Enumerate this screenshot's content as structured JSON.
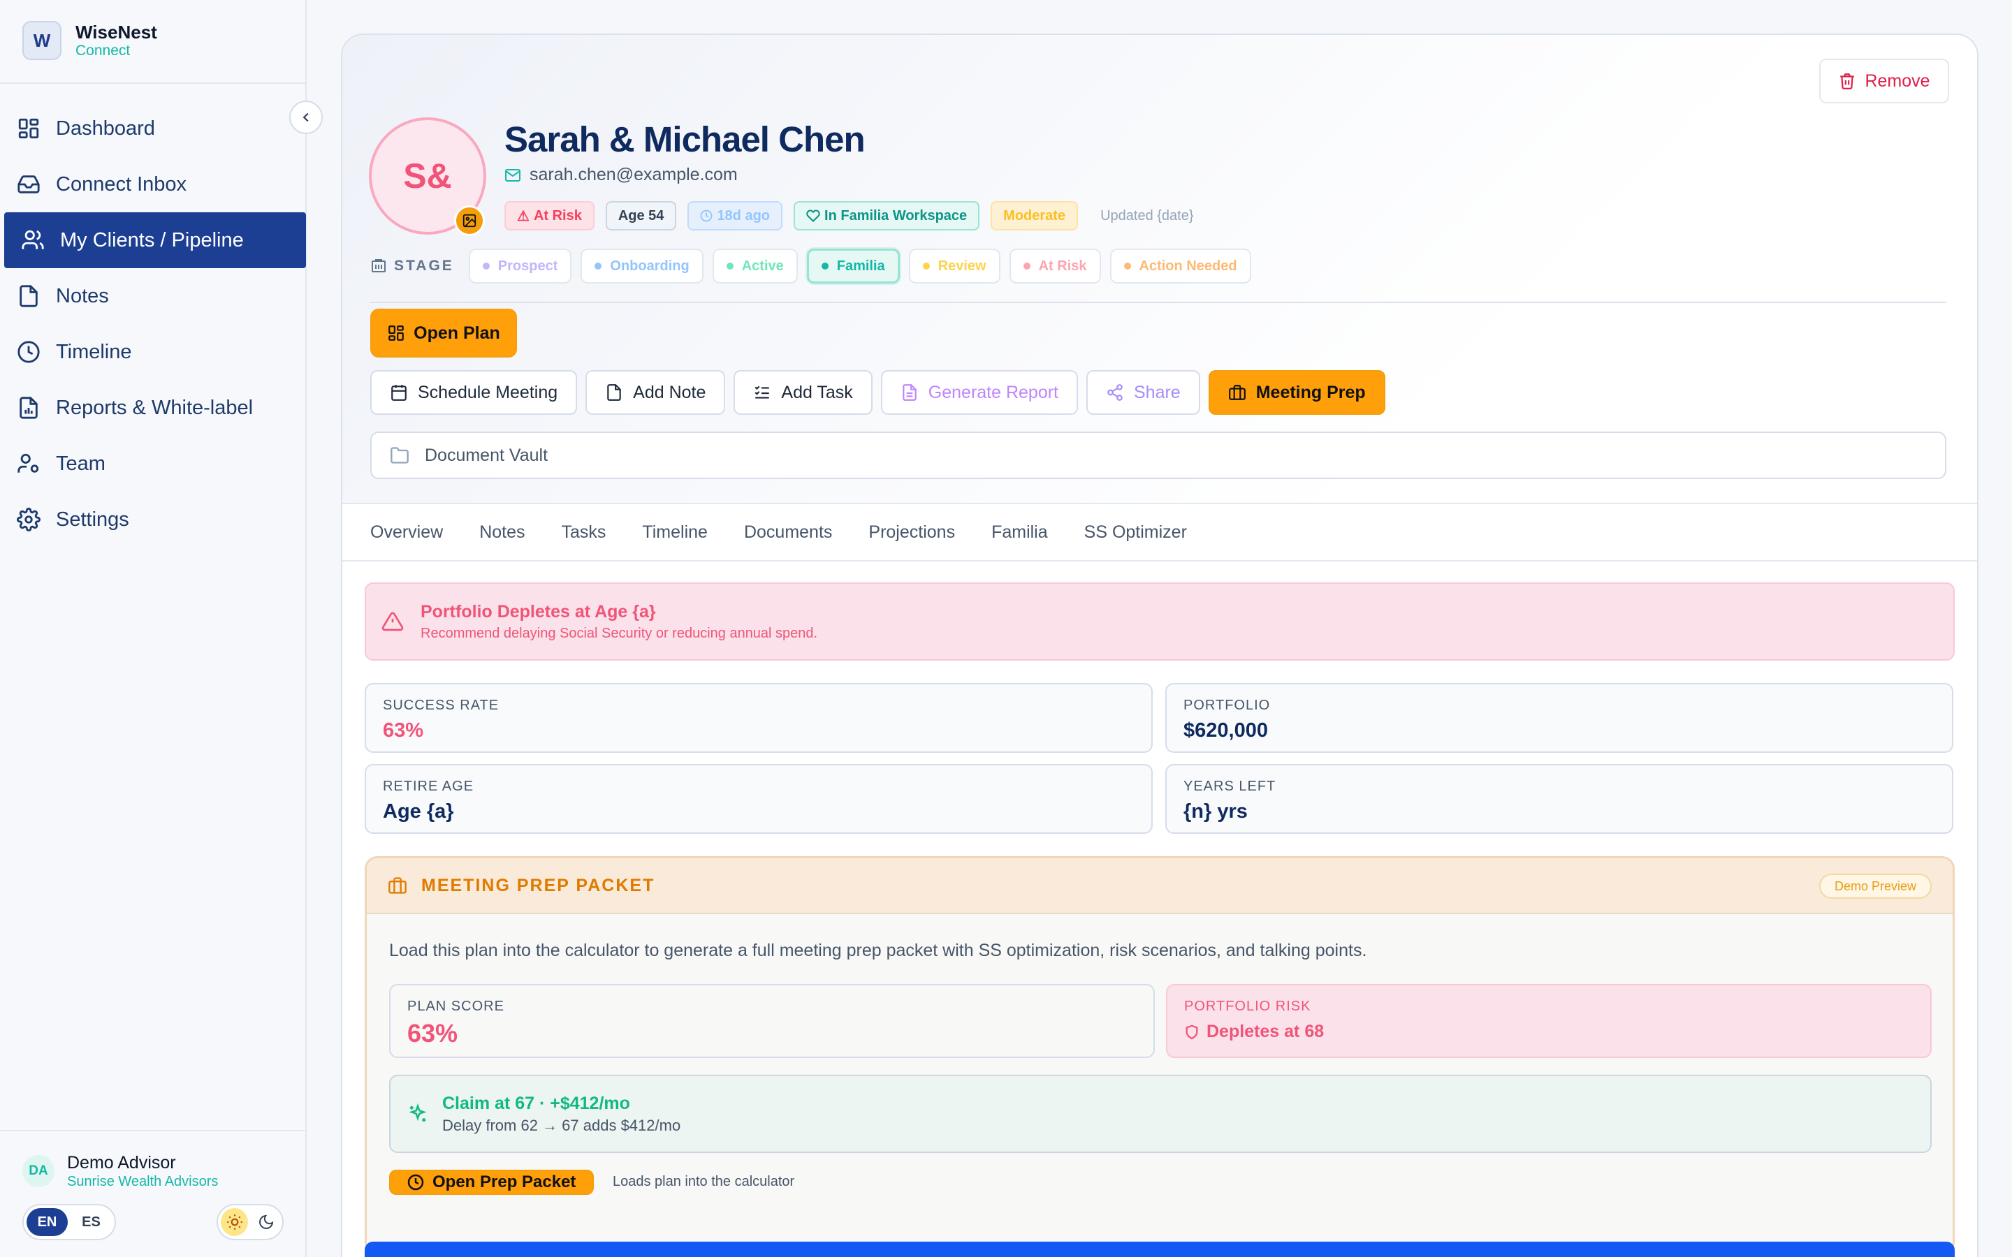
{
  "brand": {
    "name": "WiseNest",
    "sub": "Connect"
  },
  "nav": [
    {
      "label": "Dashboard",
      "icon": "dashboard-icon"
    },
    {
      "label": "Connect Inbox",
      "icon": "inbox-icon"
    },
    {
      "label": "My Clients / Pipeline",
      "icon": "users-icon",
      "active": true
    },
    {
      "label": "Notes",
      "icon": "note-icon"
    },
    {
      "label": "Timeline",
      "icon": "clock-icon"
    },
    {
      "label": "Reports & White-label",
      "icon": "report-icon"
    },
    {
      "label": "Team",
      "icon": "team-icon"
    },
    {
      "label": "Settings",
      "icon": "gear-icon"
    }
  ],
  "user": {
    "initials": "DA",
    "name": "Demo Advisor",
    "org": "Sunrise Wealth Advisors"
  },
  "lang": {
    "en": "EN",
    "es": "ES",
    "active": "EN"
  },
  "client": {
    "initials": "S&",
    "name": "Sarah & Michael Chen",
    "email": "sarah.chen@example.com",
    "remove_label": "Remove",
    "tags": {
      "risk": "At Risk",
      "age": "Age 54",
      "days": "18d ago",
      "familia": "In Familia Workspace",
      "risk_profile": "Moderate",
      "updated": "Updated {date}"
    }
  },
  "stage": {
    "label": "STAGE",
    "chips": [
      {
        "label": "Prospect",
        "color": "#c4b5fd"
      },
      {
        "label": "Onboarding",
        "color": "#93c5fd"
      },
      {
        "label": "Active",
        "color": "#6ee7b7"
      },
      {
        "label": "Familia",
        "color": "#14b8a6",
        "selected": true
      },
      {
        "label": "Review",
        "color": "#fcd34d"
      },
      {
        "label": "At Risk",
        "color": "#fda4af"
      },
      {
        "label": "Action Needed",
        "color": "#fdba74"
      }
    ]
  },
  "actions": {
    "open_plan": "Open Plan",
    "schedule": "Schedule Meeting",
    "add_note": "Add Note",
    "add_task": "Add Task",
    "generate": "Generate Report",
    "share": "Share",
    "meeting_prep": "Meeting Prep",
    "vault": "Document Vault"
  },
  "tabs": [
    "Overview",
    "Notes",
    "Tasks",
    "Timeline",
    "Documents",
    "Projections",
    "Familia",
    "SS Optimizer"
  ],
  "alert": {
    "title": "Portfolio Depletes at Age {a}",
    "sub": "Recommend delaying Social Security or reducing annual spend."
  },
  "stats": {
    "success": {
      "label": "SUCCESS RATE",
      "value": "63%"
    },
    "portfolio": {
      "label": "PORTFOLIO",
      "value": "$620,000"
    },
    "retire": {
      "label": "RETIRE AGE",
      "value": "Age {a}"
    },
    "years": {
      "label": "YEARS LEFT",
      "value": "{n} yrs"
    }
  },
  "prep": {
    "title": "MEETING PREP PACKET",
    "badge": "Demo Preview",
    "desc": "Load this plan into the calculator to generate a full meeting prep packet with SS optimization, risk scenarios, and talking points.",
    "score_label": "PLAN SCORE",
    "score_value": "63%",
    "risk_label": "PORTFOLIO RISK",
    "risk_value": "Depletes at 68",
    "claim_title": "Claim at 67 · +$412/mo",
    "claim_sub": "Delay from 62 → 67 adds $412/mo",
    "open_label": "Open Prep Packet",
    "open_note": "Loads plan into the calculator"
  }
}
